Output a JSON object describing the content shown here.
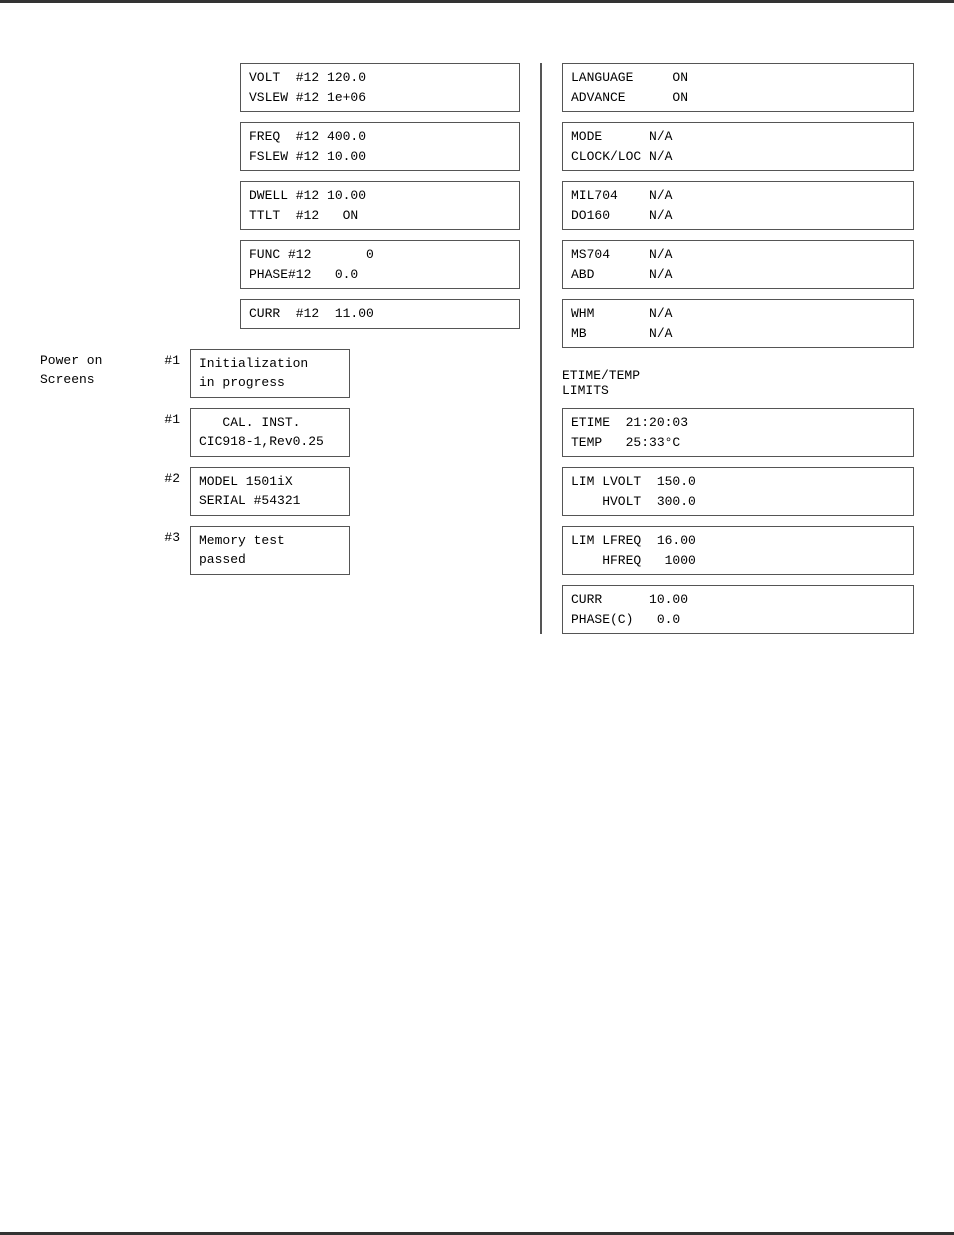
{
  "leftBoxes": {
    "voltVslew": {
      "line1": "VOLT  #12 120.0",
      "line2": "VSLEW #12 1e+06"
    },
    "freqFslew": {
      "line1": "FREQ  #12 400.0",
      "line2": "FSLEW #12 10.00"
    },
    "dwellTtlt": {
      "line1": "DWELL #12 10.00",
      "line2": "TTLT  #12   ON"
    },
    "funcPhase": {
      "line1": "FUNC #12       0",
      "line2": "PHASE#12   0.0"
    },
    "curr": {
      "line1": "CURR  #12  11.00"
    }
  },
  "powerOnScreens": {
    "label": {
      "line1": "Power on",
      "line2": "Screens"
    },
    "items": [
      {
        "number": "#1",
        "line1": "Initialization",
        "line2": "in progress"
      },
      {
        "number": "#1",
        "line1": "   CAL. INST.",
        "line2": "CIC918-1,Rev0.25"
      },
      {
        "number": "#2",
        "line1": "MODEL 1501iX",
        "line2": "SERIAL #54321"
      },
      {
        "number": "#3",
        "line1": "Memory test",
        "line2": "passed"
      }
    ]
  },
  "rightBoxes": {
    "languageAdvance": {
      "line1": "LANGUAGE     ON",
      "line2": "ADVANCE      ON"
    },
    "modeClock": {
      "line1": "MODE      N/A",
      "line2": "CLOCK/LOC N/A"
    },
    "milDo": {
      "line1": "MIL704    N/A",
      "line2": "DO160     N/A"
    },
    "ms704Abd": {
      "line1": "MS704     N/A",
      "line2": "ABD       N/A"
    },
    "whmMb": {
      "line1": "WHM       N/A",
      "line2": "MB        N/A"
    }
  },
  "etimeTemp": {
    "label": {
      "line1": "ETIME/TEMP",
      "line2": "LIMITS"
    },
    "boxes": {
      "etimeTemp": {
        "line1": "ETIME  21:20:03",
        "line2": "TEMP   25:33°C"
      },
      "limVolt": {
        "line1": "LIM LVOLT  150.0",
        "line2": "    HVOLT  300.0"
      },
      "limFreq": {
        "line1": "LIM LFREQ  16.00",
        "line2": "    HFREQ   1000"
      },
      "currPhase": {
        "line1": "CURR      10.00",
        "line2": "PHASE(C)   0.0"
      }
    }
  }
}
